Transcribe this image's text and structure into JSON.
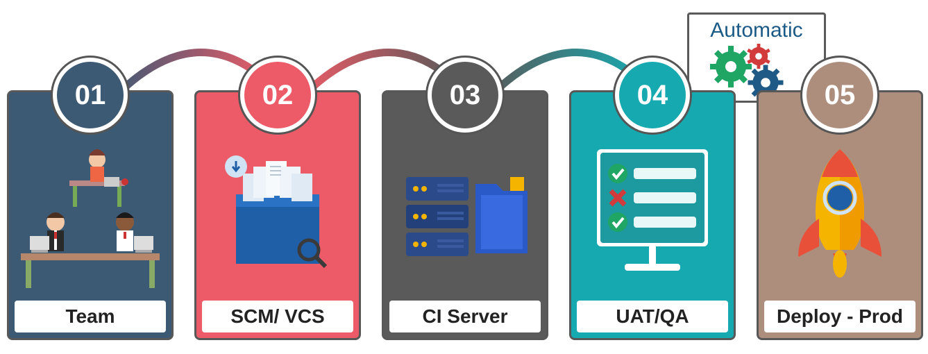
{
  "callout": {
    "title": "Automatic"
  },
  "stages": [
    {
      "num": "01",
      "label": "Team",
      "bg": "#3d5a75",
      "numbg": "#3d5a75"
    },
    {
      "num": "02",
      "label": "SCM/ VCS",
      "bg": "#ec5b67",
      "numbg": "#ec5b67"
    },
    {
      "num": "03",
      "label": "CI Server",
      "bg": "#5a5a5a",
      "numbg": "#5a5a5a"
    },
    {
      "num": "04",
      "label": "UAT/QA",
      "bg": "#16aab0",
      "numbg": "#16aab0"
    },
    {
      "num": "05",
      "label": "Deploy - Prod",
      "bg": "#ad8e7d",
      "numbg": "#ad8e7d"
    }
  ],
  "arrows": [
    {
      "from": 0,
      "to": 1,
      "c1": "#3d5a75",
      "c2": "#ec5b67"
    },
    {
      "from": 1,
      "to": 2,
      "c1": "#ec5b67",
      "c2": "#5a5a5a"
    },
    {
      "from": 2,
      "to": 3,
      "c1": "#5a5a5a",
      "c2": "#16aab0"
    },
    {
      "from": 3,
      "to": 4,
      "c1": "#16aab0",
      "c2": "#ad8e7d"
    }
  ]
}
